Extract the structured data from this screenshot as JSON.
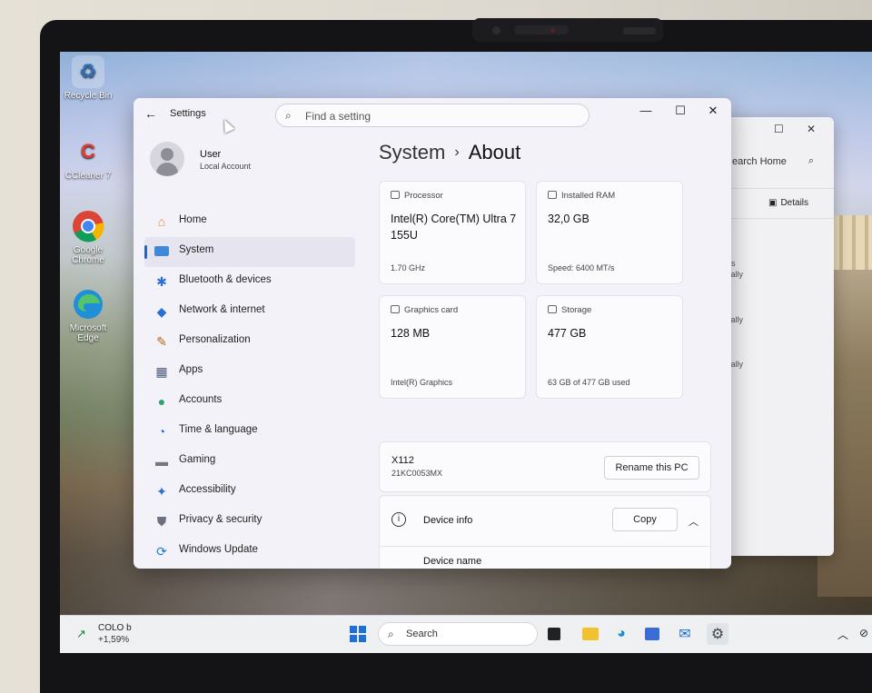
{
  "desktop": {
    "icons": [
      {
        "label": "Recycle Bin",
        "icon": "recycle-bin-icon"
      },
      {
        "label": "CCleaner 7",
        "icon": "ccleaner-icon"
      },
      {
        "label": "Google Chrome",
        "icon": "chrome-icon"
      },
      {
        "label": "Microsoft Edge",
        "icon": "edge-icon"
      }
    ]
  },
  "back_window": {
    "search_text": "earch Home",
    "details_label": "Details",
    "snippets": [
      "ds",
      "cally",
      "cally",
      "cally"
    ]
  },
  "settings": {
    "title": "Settings",
    "search_placeholder": "Find a setting",
    "profile": {
      "name": "User",
      "account_type": "Local Account"
    },
    "nav": [
      {
        "label": "Home",
        "icon": "home-icon"
      },
      {
        "label": "System",
        "icon": "system-icon",
        "active": true
      },
      {
        "label": "Bluetooth & devices",
        "icon": "bluetooth-icon"
      },
      {
        "label": "Network & internet",
        "icon": "wifi-icon"
      },
      {
        "label": "Personalization",
        "icon": "brush-icon"
      },
      {
        "label": "Apps",
        "icon": "apps-icon"
      },
      {
        "label": "Accounts",
        "icon": "accounts-icon"
      },
      {
        "label": "Time & language",
        "icon": "globe-clock-icon"
      },
      {
        "label": "Gaming",
        "icon": "gamepad-icon"
      },
      {
        "label": "Accessibility",
        "icon": "accessibility-icon"
      },
      {
        "label": "Privacy & security",
        "icon": "shield-icon"
      },
      {
        "label": "Windows Update",
        "icon": "update-icon"
      }
    ],
    "breadcrumb": {
      "parent": "System",
      "current": "About"
    },
    "specs": {
      "processor": {
        "header": "Processor",
        "value": "Intel(R) Core(TM) Ultra 7 155U",
        "sub": "1.70 GHz"
      },
      "ram": {
        "header": "Installed RAM",
        "value": "32,0 GB",
        "sub": "Speed: 6400 MT/s"
      },
      "graphics": {
        "header": "Graphics card",
        "value": "128 MB",
        "sub": "Intel(R) Graphics"
      },
      "storage": {
        "header": "Storage",
        "value": "477 GB",
        "sub": "63 GB of 477 GB used"
      }
    },
    "pc": {
      "name": "X112",
      "model": "21KC0053MX",
      "rename_label": "Rename this PC"
    },
    "device_info": {
      "label": "Device info",
      "copy_label": "Copy",
      "first_row": "Device name"
    }
  },
  "taskbar": {
    "widget": {
      "title": "COLO b",
      "change": "+1,59%"
    },
    "search_label": "Search"
  },
  "colors": {
    "accent": "#2563c9",
    "positive": "#1a8a3a"
  }
}
